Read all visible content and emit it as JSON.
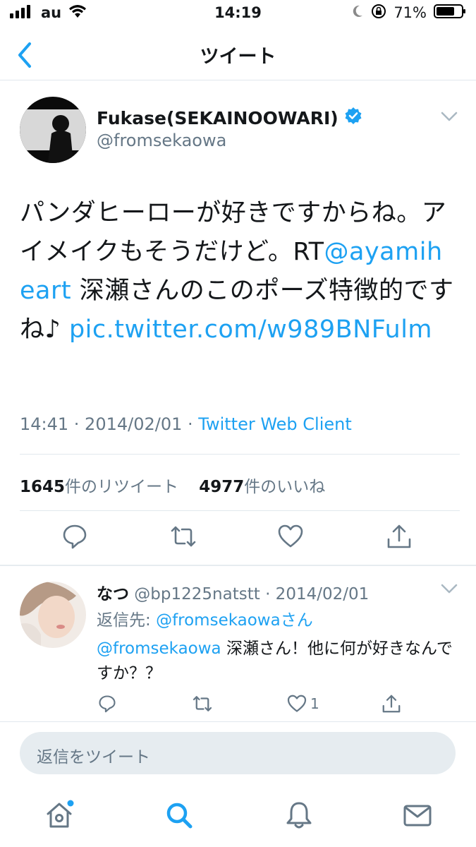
{
  "status_bar": {
    "carrier": "au",
    "time": "14:19",
    "battery": "71%"
  },
  "nav": {
    "title": "ツイート"
  },
  "tweet": {
    "author_name": "Fukase(SEKAINOOWARI)",
    "author_handle": "@fromsekaowa",
    "text_part1": "パンダヒーローが好きですからね。アイメイクもそうだけど。RT",
    "mention": "@ayamiheart",
    "text_part2": " 深瀬さんのこのポーズ特徴的ですね♪ ",
    "link": "pic.twitter.com/w989BNFulm",
    "time": "14:41 · 2014/02/01 · ",
    "source": "Twitter Web Client",
    "retweet_count": "1645",
    "retweet_label": "件のリツイート",
    "like_count": "4977",
    "like_label": "件のいいね"
  },
  "reply": {
    "name": "なつ",
    "handle_date": " @bp1225natstt · 2014/02/01",
    "reply_to_label": "返信先: ",
    "reply_to_handle": "@fromsekaowaさん",
    "mention": "@fromsekaowa",
    "text": " 深瀬さん！他に何が好きなんですか？？",
    "like_count": "1"
  },
  "compose": {
    "placeholder": "返信をツイート"
  },
  "colors": {
    "accent": "#1da1f2",
    "secondary_text": "#657786",
    "verified": "#1da1f2"
  }
}
